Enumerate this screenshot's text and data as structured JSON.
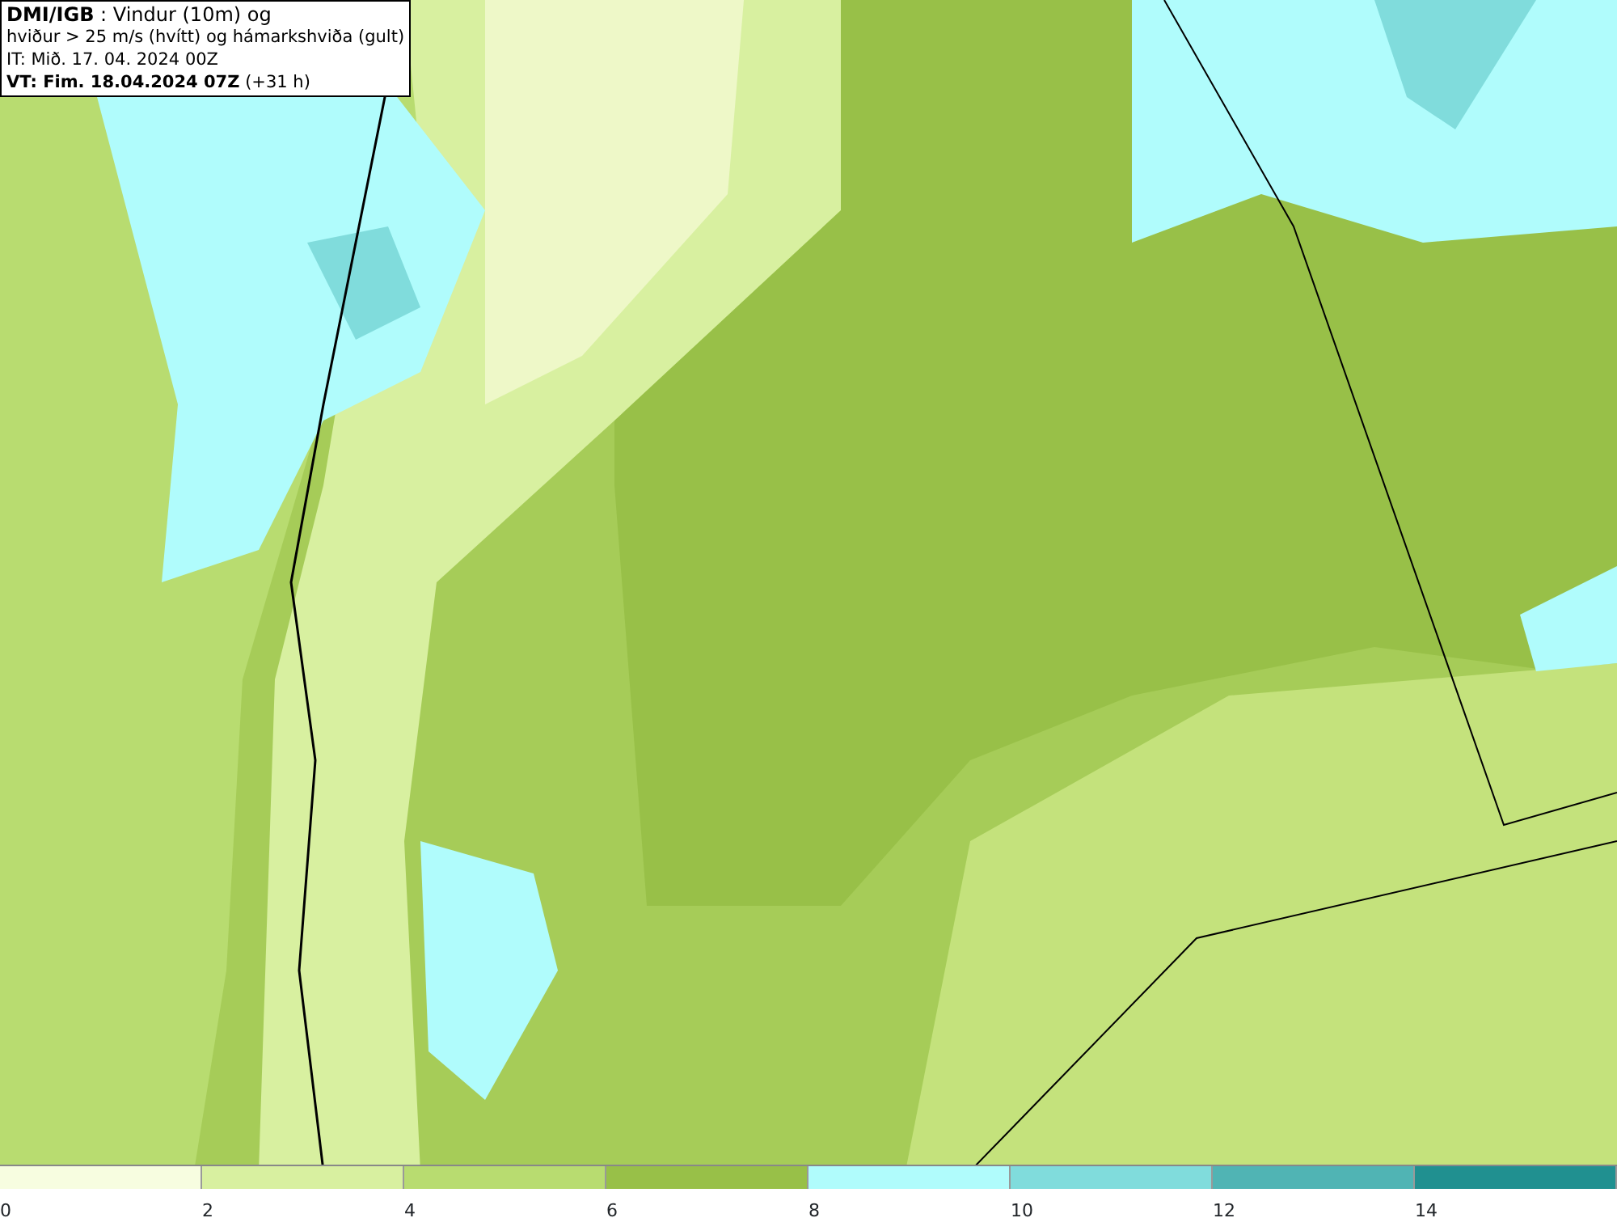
{
  "title_box": {
    "lines": [
      "**DMI/IGB** : Vindur (10m) og",
      "hviður > 25 m/s (hvítt) og hámarkshviða (gult)",
      "IT: Mið. 17. 04. 2024 00Z",
      "**VT: Fim. 18.04.2024 07Z** (+31 h)"
    ]
  },
  "legend": [
    {
      "label": "0",
      "color": "#f7fde0"
    },
    {
      "label": "2",
      "color": "#d8f0a0"
    },
    {
      "label": "4",
      "color": "#b8dc70"
    },
    {
      "label": "6",
      "color": "#98c048"
    },
    {
      "label": "8",
      "color": "#b0fcfc"
    },
    {
      "label": "10",
      "color": "#80dcdc"
    },
    {
      "label": "12",
      "color": "#50b4b4"
    },
    {
      "label": "14",
      "color": "#209090"
    }
  ]
}
